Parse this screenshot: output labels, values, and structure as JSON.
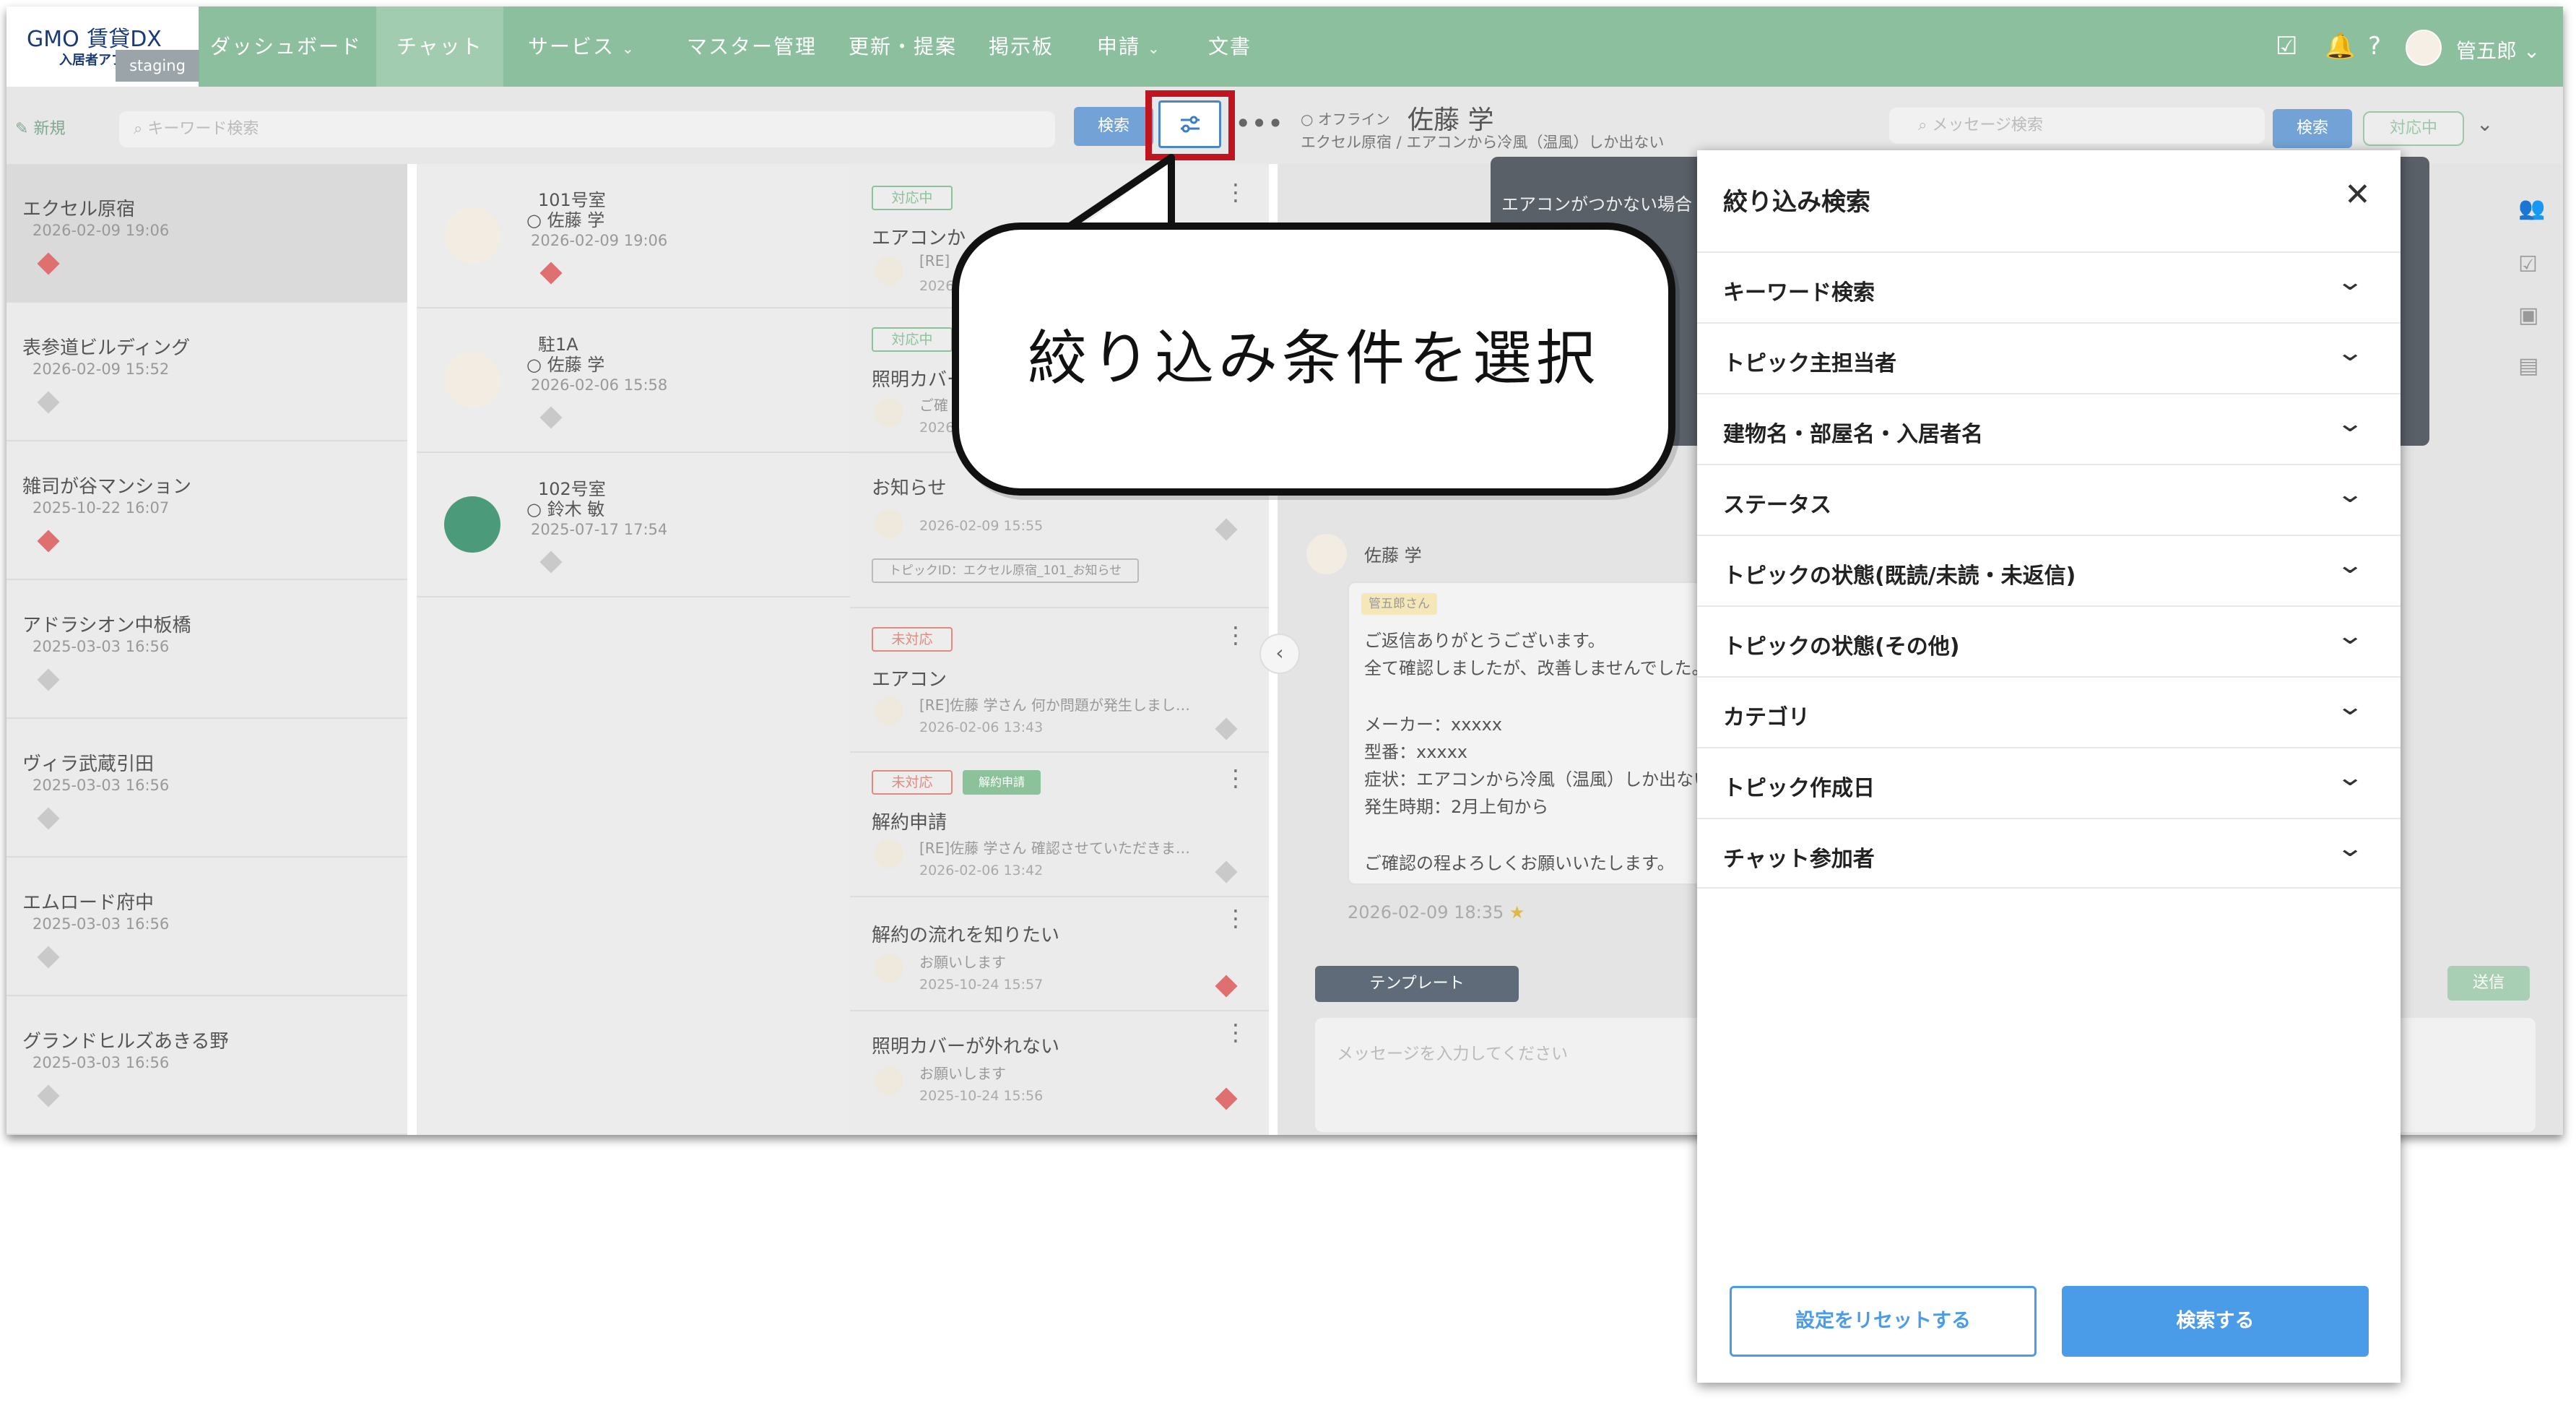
{
  "app": {
    "logo_text": "GMO",
    "logo_sub_text": "賃貸DX",
    "logo_caption": "入居者アプリ",
    "env_badge": "staging"
  },
  "nav": {
    "items": [
      {
        "label": "ダッシュボード"
      },
      {
        "label": "チャット"
      },
      {
        "label": "サービス"
      },
      {
        "label": "マスター管理"
      },
      {
        "label": "更新・提案"
      },
      {
        "label": "掲示板"
      },
      {
        "label": "申請"
      },
      {
        "label": "文書"
      }
    ],
    "user_name": "管五郎"
  },
  "toolbar": {
    "new_label": "新規",
    "search_placeholder": "キーワード検索",
    "search_button": "検索"
  },
  "buildings": [
    {
      "name": "エクセル原宿",
      "date": "2026-02-09 19:06",
      "flag": "#e06f6f"
    },
    {
      "name": "表参道ビルディング",
      "date": "2026-02-09 15:52",
      "flag": "#c9c9c9"
    },
    {
      "name": "雑司が谷マンション",
      "date": "2025-10-22 16:07",
      "flag": "#e06f6f"
    },
    {
      "name": "アドラシオン中板橋",
      "date": "2025-03-03 16:56",
      "flag": "#c9c9c9"
    },
    {
      "name": "ヴィラ武蔵引田",
      "date": "2025-03-03 16:56",
      "flag": "#c9c9c9"
    },
    {
      "name": "エムロード府中",
      "date": "2025-03-03 16:56",
      "flag": "#c9c9c9"
    },
    {
      "name": "グランドヒルズあきる野",
      "date": "2025-03-03 16:56",
      "flag": "#c9c9c9"
    }
  ],
  "rooms": [
    {
      "room": "101号室",
      "person": "佐藤 学",
      "date": "2026-02-09 19:06"
    },
    {
      "room": "駐1A",
      "person": "佐藤 学",
      "date": "2026-02-06 15:58"
    },
    {
      "room": "102号室",
      "person": "鈴木 敏",
      "date": "2025-07-17 17:54"
    }
  ],
  "topics": [
    {
      "status": "対応中",
      "title": "エアコンか",
      "sub": "[RE]",
      "date": "2026-"
    },
    {
      "status": "対応中",
      "title": "照明カバー",
      "sub": "ご確",
      "date": "2026-"
    },
    {
      "title": "お知らせ",
      "date": "2026-02-09 15:55",
      "topic_id": "トピックID：エクセル原宿_101_お知らせ"
    },
    {
      "status": "未対応",
      "title": "エアコン",
      "sub": "[RE]佐藤 学さん 何か問題が発生しまし…",
      "date": "2026-02-06 13:43"
    },
    {
      "status": "未対応",
      "tag": "解約申請",
      "title": "解約申請",
      "sub": "[RE]佐藤 学さん 確認させていただきま…",
      "date": "2026-02-06 13:42"
    },
    {
      "title": "解約の流れを知りたい",
      "sub": "お願いします",
      "date": "2025-10-24 15:57"
    },
    {
      "title": "照明カバーが外れない",
      "sub": "お願いします",
      "date": "2025-10-24 15:56"
    }
  ],
  "chat": {
    "presence": "オフライン",
    "name": "佐藤 学",
    "subtitle": "エクセル原宿 / エアコンから冷風（温風）しか出ない",
    "search_placeholder": "メッセージ検索",
    "search_button": "検索",
    "status_label": "対応中",
    "preview_text": "エアコンがつかない場合",
    "sender": "佐藤 学",
    "reply_tag": "管五郎さん",
    "message_lines": [
      "ご返信ありがとうございます。",
      "全て確認しましたが、改善しませんでした。",
      "",
      "メーカー：xxxxx",
      "型番：xxxxx",
      "症状：エアコンから冷風（温風）しか出ない",
      "発生時期：2月上旬から",
      "",
      "ご確認の程よろしくお願いいたします。"
    ],
    "message_date": "2026-02-09 18:35",
    "template_button": "テンプレート",
    "input_placeholder": "メッセージを入力してください",
    "send_button": "送信"
  },
  "callout": {
    "text": "絞り込み条件を選択"
  },
  "filter_panel": {
    "title": "絞り込み検索",
    "sections": [
      {
        "label": "キーワード検索"
      },
      {
        "label": "トピック主担当者"
      },
      {
        "label": "建物名・部屋名・入居者名"
      },
      {
        "label": "ステータス"
      },
      {
        "label": "トピックの状態(既読/未読・未返信)"
      },
      {
        "label": "トピックの状態(その他)"
      },
      {
        "label": "カテゴリ"
      },
      {
        "label": "トピック作成日"
      },
      {
        "label": "チャット参加者"
      }
    ],
    "reset_button": "設定をリセットする",
    "search_button": "検索する"
  },
  "colors": {
    "nav_bg": "#8cbf9e",
    "accent_blue": "#4a9ce8",
    "highlight_red": "#c0151f"
  }
}
